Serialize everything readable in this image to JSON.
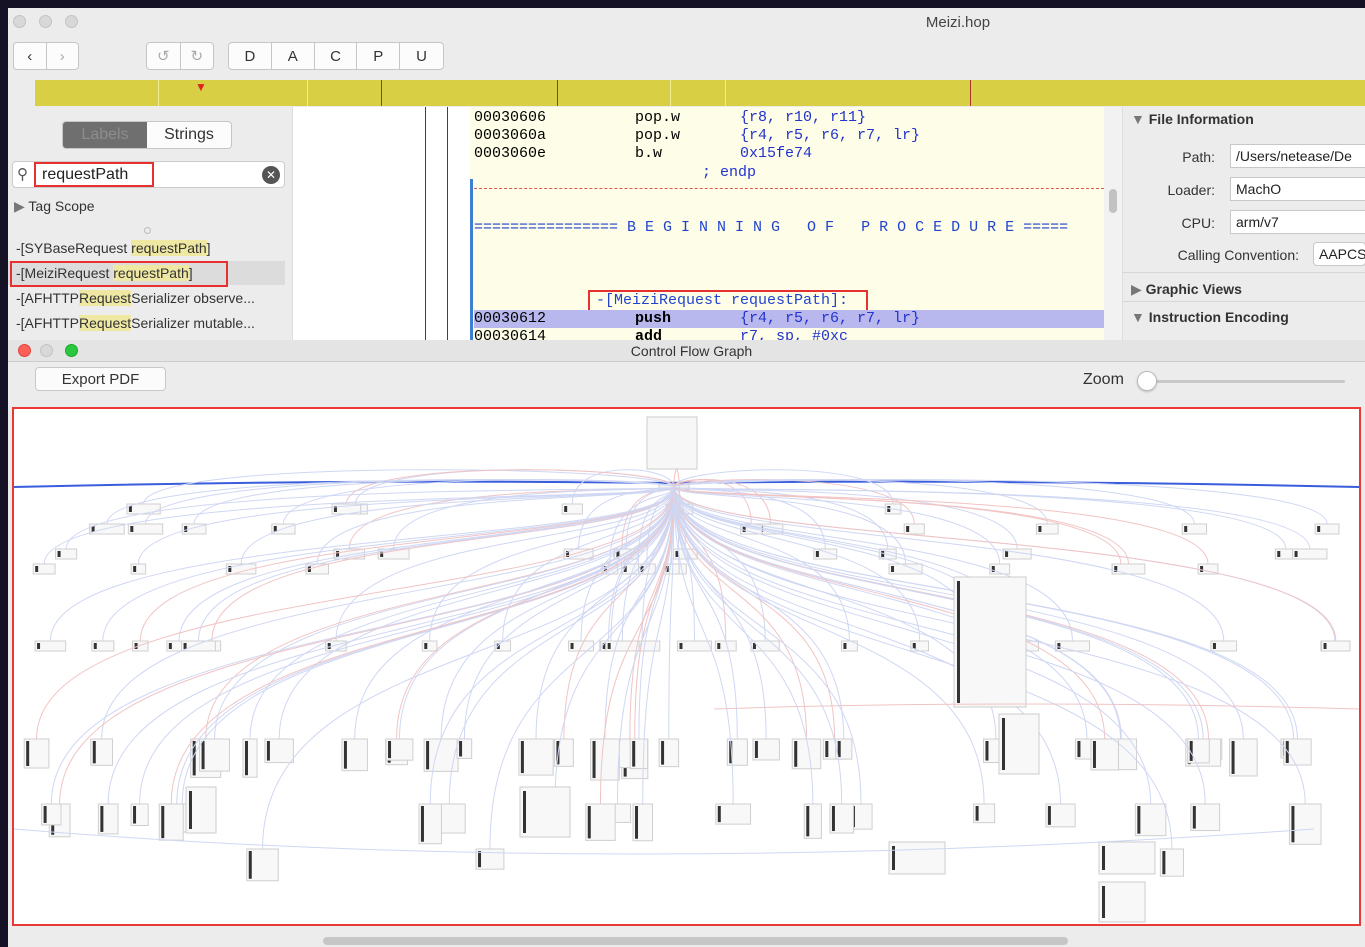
{
  "window": {
    "title": "Meizi.hop"
  },
  "toolbar": {
    "back_icon": "chevron-left-icon",
    "forward_icon": "chevron-right-icon",
    "undo_icon": "undo-icon",
    "redo_icon": "redo-icon",
    "modes": [
      "D",
      "A",
      "C",
      "P",
      "U"
    ]
  },
  "sidebar": {
    "tabs": [
      "Labels",
      "Strings"
    ],
    "search_value": "requestPath",
    "tag_scope": "Tag Scope",
    "items": [
      {
        "prefix": "-[SYBaseRequest ",
        "match": "requestPath",
        "suffix": "]"
      },
      {
        "prefix": "-[MeiziRequest ",
        "match": "requestPath",
        "suffix": "]"
      },
      {
        "prefix": "-[AFHTTP",
        "match": "Request",
        "suffix": "Serializer observe..."
      },
      {
        "prefix": "-[AFHTTP",
        "match": "Request",
        "suffix": "Serializer mutable..."
      }
    ]
  },
  "code": {
    "lines": [
      {
        "addr": "00030606",
        "op": "pop.w",
        "args": "{r8, r10, r11}"
      },
      {
        "addr": "0003060a",
        "op": "pop.w",
        "args": "{r4, r5, r6, r7, lr}"
      },
      {
        "addr": "0003060e",
        "op": "b.w",
        "args": "0x15fe74"
      }
    ],
    "endp": "; endp",
    "banner": "================ B E G I N N I N G   O F   P R O C E D U R E =====",
    "proc_name": "-[MeiziRequest requestPath]:",
    "sel_addr": "00030612",
    "sel_op": "push",
    "sel_args": "{r4, r5, r6, r7, lr}",
    "next_addr": "00030614",
    "next_op": "add",
    "next_args": "r7, sp, #0xc"
  },
  "inspector": {
    "file_info": "File Information",
    "path_label": "Path:",
    "path_value": "/Users/netease/De",
    "loader_label": "Loader:",
    "loader_value": "MachO",
    "cpu_label": "CPU:",
    "cpu_value": "arm/v7",
    "cc_label": "Calling Convention:",
    "cc_value": "AAPCS",
    "graphic_views": "Graphic Views",
    "instruction_encoding": "Instruction Encoding"
  },
  "cfg": {
    "title": "Control Flow Graph",
    "export_label": "Export PDF",
    "zoom_label": "Zoom",
    "zoom_level": 0.0
  }
}
